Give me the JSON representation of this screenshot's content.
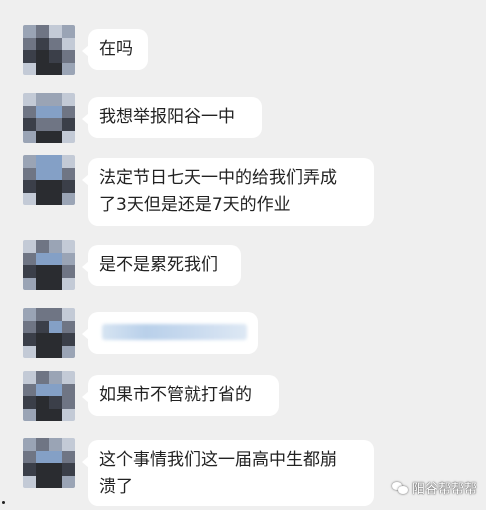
{
  "messages": [
    {
      "text": "在吗"
    },
    {
      "text": "我想举报阳谷一中"
    },
    {
      "line1": "法定节日七天一中的给我们弄成",
      "line2": "了3天但是还是7天的作业"
    },
    {
      "text": "是不是累死我们"
    },
    {
      "text": ""
    },
    {
      "text": "如果市不管就打省的"
    },
    {
      "line1": "这个事情我们这一届高中生都崩",
      "line2": "溃了"
    }
  ],
  "watermark": {
    "icon": "wechat-icon",
    "label": "阳谷帮帮帮"
  },
  "colors": {
    "background": "#efefef",
    "bubble": "#ffffff",
    "text": "#222222",
    "avatar_pixels": [
      "#3b3f49",
      "#6f7584",
      "#9aa4b5",
      "#c3cad6",
      "#2a2c30",
      "#84a0c6"
    ]
  }
}
